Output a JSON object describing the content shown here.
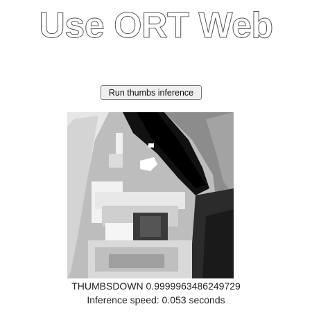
{
  "page": {
    "title": "Use ORT Web"
  },
  "controls": {
    "run_button_label": "Run thumbs inference"
  },
  "result": {
    "prediction_line": "THUMBSDOWN 0.9999963486249729",
    "speed_line": "Inference speed: 0.053 seconds"
  },
  "image": {
    "description_icon": "grayscale-input-image"
  }
}
